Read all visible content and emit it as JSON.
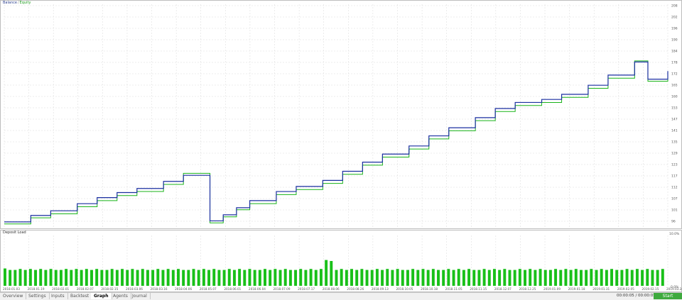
{
  "legend": {
    "balance_label": "Balance",
    "equity_label": "Equity",
    "separator": "/"
  },
  "load_title": "Deposit Load",
  "tabs": [
    {
      "label": "Overview",
      "active": false
    },
    {
      "label": "Settings",
      "active": false
    },
    {
      "label": "Inputs",
      "active": false
    },
    {
      "label": "Backtest",
      "active": false
    },
    {
      "label": "Graph",
      "active": true
    },
    {
      "label": "Agents",
      "active": false
    },
    {
      "label": "Journal",
      "active": false
    }
  ],
  "timer": "00:00:05 / 00:00:05",
  "start_label": "Start",
  "colors": {
    "balance": "#1a2fa0",
    "equity": "#19b319",
    "load": "#19c019",
    "grid": "#d9d9d9"
  },
  "chart_data": [
    {
      "type": "line",
      "title": "",
      "ylim": [
        95,
        205
      ],
      "yticks": [
        "96",
        "101",
        "107",
        "112",
        "117",
        "123",
        "129",
        "135",
        "141",
        "147",
        "153",
        "160",
        "165",
        "172",
        "178",
        "184",
        "190",
        "196",
        "202",
        "208"
      ],
      "xticks": [
        "2018.01.03",
        "2018.01.19",
        "2018.02.01",
        "2018.02.07",
        "2018.02.15",
        "2018.03.06",
        "2018.03.16",
        "2018.04.06",
        "2018.05.07",
        "2018.06.01",
        "2018.06.04",
        "2018.07.09",
        "2018.07.17",
        "2018.08.06",
        "2018.08.26",
        "2018.09.13",
        "2018.10.05",
        "2018.10.18",
        "2018.11.05",
        "2018.11.15",
        "2018.12.07",
        "2018.12.25",
        "2019.01.09",
        "2019.01.18",
        "2019.01.31",
        "2019.02.05",
        "2019.02.15",
        "2019.03.24"
      ],
      "grid": true,
      "legend": "top-left",
      "series": [
        {
          "name": "Balance",
          "x": [
            0,
            4,
            7,
            11,
            14,
            17,
            20,
            24,
            27,
            31,
            33,
            35,
            37,
            41,
            44,
            48,
            51,
            54,
            57,
            61,
            64,
            67,
            71,
            74,
            77,
            81,
            84,
            88,
            91,
            95,
            97,
            100
          ],
          "values": [
            97.5,
            100.7,
            103.0,
            106.5,
            109.5,
            112.0,
            114.0,
            117.5,
            120.5,
            98.0,
            101.0,
            104.5,
            108.0,
            112.5,
            115.0,
            118.0,
            122.5,
            127.0,
            131.0,
            135.0,
            140.0,
            144.0,
            149.0,
            153.5,
            156.5,
            158.0,
            160.5,
            165.0,
            170.0,
            176.5,
            168.0,
            172.0
          ]
        },
        {
          "name": "Equity",
          "x": [
            0,
            4,
            7,
            11,
            14,
            17,
            20,
            24,
            27,
            31,
            33,
            35,
            37,
            41,
            44,
            48,
            51,
            54,
            57,
            61,
            64,
            67,
            71,
            74,
            77,
            81,
            84,
            88,
            91,
            95,
            97,
            100
          ],
          "values": [
            96.5,
            99.5,
            101.5,
            105.0,
            108.0,
            110.5,
            112.5,
            116.0,
            121.5,
            97.0,
            100.0,
            103.5,
            106.5,
            111.0,
            113.5,
            116.5,
            121.0,
            125.5,
            129.5,
            133.5,
            138.5,
            142.5,
            147.5,
            152.0,
            155.0,
            156.5,
            159.0,
            163.5,
            168.5,
            177.0,
            167.0,
            171.0
          ]
        }
      ]
    },
    {
      "type": "bar",
      "title": "Deposit Load",
      "ylim": [
        0,
        10
      ],
      "yticks": [
        "10.0%",
        "0.0%"
      ],
      "series": [
        {
          "name": "",
          "values": [
            3.5,
            3.2,
            3.2,
            3.4,
            3.2,
            3.4,
            3.2,
            3.4,
            3.2,
            3.4,
            3.2,
            3.2,
            3.4,
            3.2,
            3.4,
            3.2,
            3.4,
            3.2,
            3.4,
            3.2,
            3.2,
            3.4,
            3.2,
            3.4,
            3.2,
            3.4,
            3.2,
            3.4,
            3.2,
            3.2,
            3.4,
            3.2,
            3.4,
            3.2,
            3.4,
            3.2,
            3.2,
            3.4,
            3.2,
            3.4,
            3.2,
            3.4,
            3.2,
            3.2,
            3.4,
            3.2,
            3.4,
            3.2,
            3.4,
            3.2,
            3.2,
            3.4,
            3.2,
            3.4,
            3.2,
            3.4,
            3.2,
            3.2,
            3.4,
            3.2,
            3.4,
            3.2,
            3.4,
            5.2,
            5.0,
            3.2,
            3.4,
            3.2,
            3.4,
            3.2,
            3.4,
            3.2,
            3.2,
            3.4,
            3.2,
            3.4,
            3.2,
            3.4,
            3.2,
            3.2,
            3.4,
            3.2,
            3.4,
            3.2,
            3.4,
            3.2,
            3.2,
            3.4,
            3.2,
            3.4,
            3.2,
            3.4,
            3.2,
            3.2,
            3.4,
            3.2,
            3.4,
            3.2,
            3.4,
            3.2,
            3.2,
            3.4,
            3.2,
            3.4,
            3.2,
            3.4,
            3.2,
            3.2,
            3.4,
            3.2,
            3.4,
            3.2,
            3.4,
            3.2,
            3.2,
            3.4,
            3.2,
            3.4,
            3.2,
            3.4,
            3.2,
            3.2,
            3.4,
            3.2,
            3.4,
            3.2,
            3.4,
            3.2,
            3.2,
            3.4
          ]
        }
      ]
    }
  ]
}
